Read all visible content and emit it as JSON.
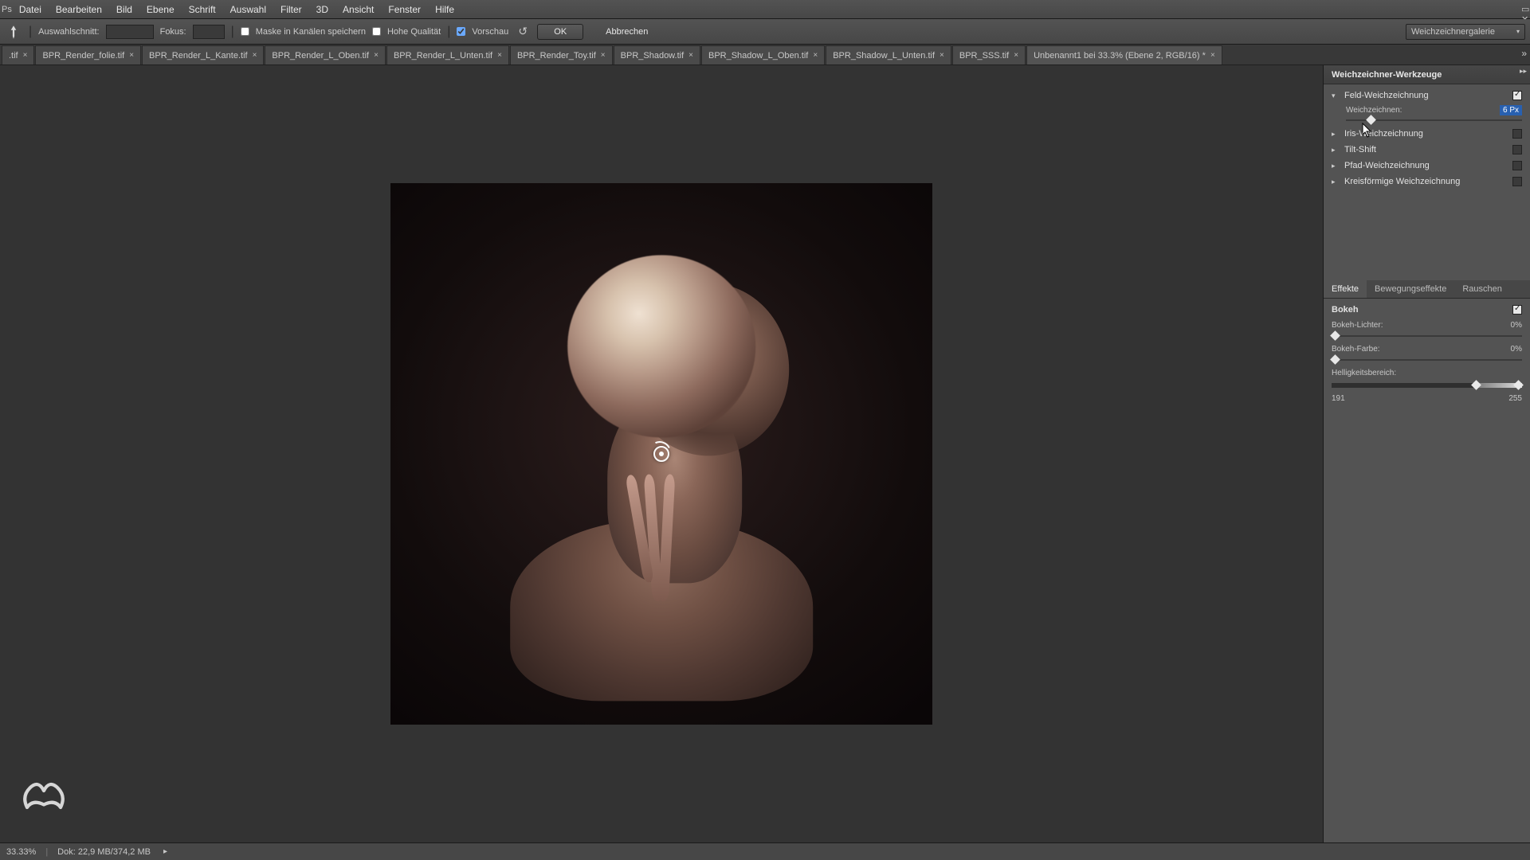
{
  "menubar": [
    "Datei",
    "Bearbeiten",
    "Bild",
    "Ebene",
    "Schrift",
    "Auswahl",
    "Filter",
    "3D",
    "Ansicht",
    "Fenster",
    "Hilfe"
  ],
  "options": {
    "tool_label": "Auswahlschnitt:",
    "fokus_label": "Fokus:",
    "mask_label": "Maske in Kanälen speichern",
    "quality_label": "Hohe Qualität",
    "preview_label": "Vorschau",
    "ok_label": "OK",
    "cancel_label": "Abbrechen",
    "dropdown_label": "Weichzeichnergalerie"
  },
  "tabs": [
    {
      "label": ".tif"
    },
    {
      "label": "BPR_Render_folie.tif"
    },
    {
      "label": "BPR_Render_L_Kante.tif"
    },
    {
      "label": "BPR_Render_L_Oben.tif"
    },
    {
      "label": "BPR_Render_L_Unten.tif"
    },
    {
      "label": "BPR_Render_Toy.tif"
    },
    {
      "label": "BPR_Shadow.tif"
    },
    {
      "label": "BPR_Shadow_L_Oben.tif"
    },
    {
      "label": "BPR_Shadow_L_Unten.tif"
    },
    {
      "label": "BPR_SSS.tif"
    },
    {
      "label": "Unbenannt1 bei 33.3% (Ebene 2, RGB/16) *",
      "active": true
    }
  ],
  "panel1": {
    "title": "Weichzeichner-Werkzeuge",
    "field_blur": "Feld-Weichzeichnung",
    "blur_label": "Weichzeichnen:",
    "blur_value": "6 Px",
    "iris": "Iris-Weichzeichnung",
    "tilt": "Tilt-Shift",
    "path": "Pfad-Weichzeichnung",
    "spin": "Kreisförmige Weichzeichnung"
  },
  "panel2": {
    "tab_effekte": "Effekte",
    "tab_motion": "Bewegungseffekte",
    "tab_noise": "Rauschen",
    "bokeh": "Bokeh",
    "bokeh_light": "Bokeh-Lichter:",
    "bokeh_light_val": "0%",
    "bokeh_color": "Bokeh-Farbe:",
    "bokeh_color_val": "0%",
    "bright_range": "Helligkeitsbereich:",
    "range_min": "191",
    "range_max": "255"
  },
  "statusbar": {
    "zoom": "33.33%",
    "doc": "Dok: 22,9 MB/374,2 MB"
  }
}
